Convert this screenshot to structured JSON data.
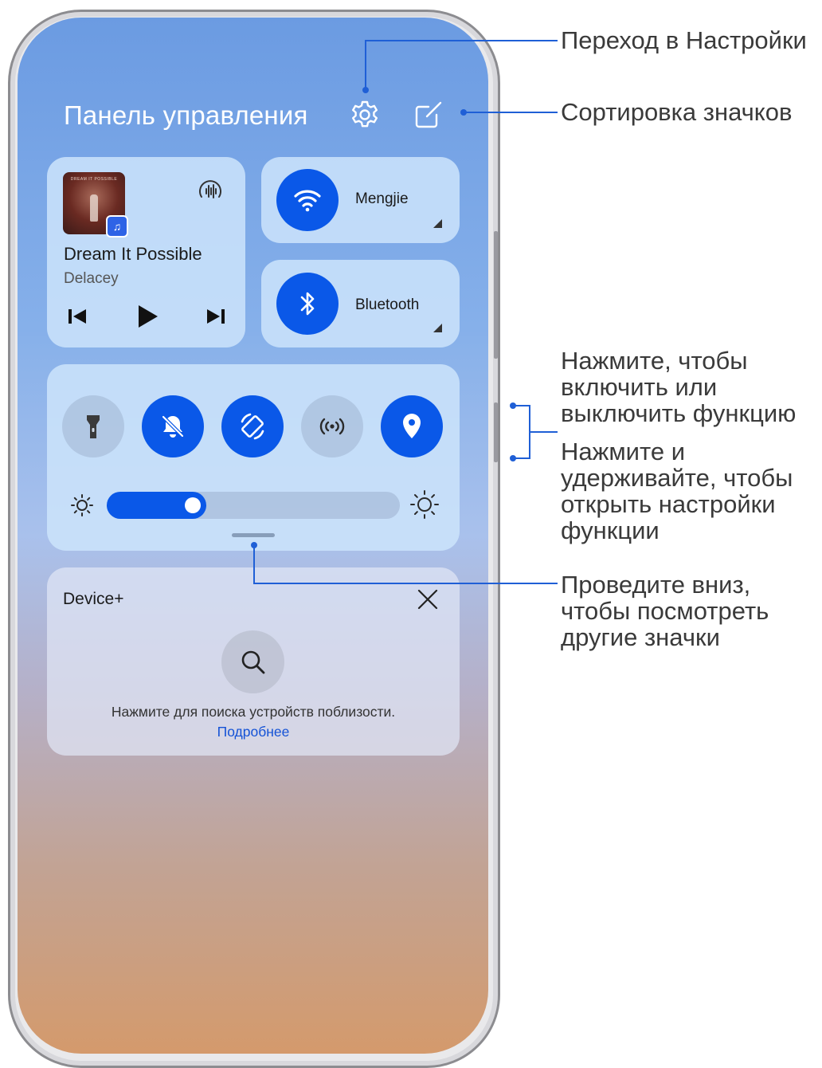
{
  "panel": {
    "title": "Панель управления"
  },
  "media": {
    "song": "Dream It Possible",
    "artist": "Delacey",
    "album_art_text": "DREAM IT POSSIBLE"
  },
  "wifi": {
    "label": "Mengjie"
  },
  "bluetooth": {
    "label": "Bluetooth"
  },
  "toggles": [
    {
      "icon": "flashlight-icon",
      "on": false
    },
    {
      "icon": "mute-bell-icon",
      "on": true
    },
    {
      "icon": "auto-rotate-icon",
      "on": true
    },
    {
      "icon": "nfc-icon",
      "on": false
    },
    {
      "icon": "location-icon",
      "on": true
    }
  ],
  "brightness": {
    "level": 0.34
  },
  "device_plus": {
    "title": "Device+",
    "hint": "Нажмите для поиска устройств поблизости.",
    "link": "Подробнее"
  },
  "annotations": {
    "settings": "Переход в Настройки",
    "sort": "Сортировка значков",
    "toggle_line1": "Нажмите, чтобы",
    "toggle_line2": "включить или",
    "toggle_line3": "выключить функцию",
    "hold_line1": "Нажмите и",
    "hold_line2": "удерживайте, чтобы",
    "hold_line3": "открыть настройки",
    "hold_line4": "функции",
    "swipe_line1": "Проведите вниз,",
    "swipe_line2": "чтобы посмотреть",
    "swipe_line3": "другие значки"
  },
  "colors": {
    "accent_blue": "#0a58e8",
    "annotation_line": "#1f5fd6",
    "link_blue": "#1452d6"
  }
}
